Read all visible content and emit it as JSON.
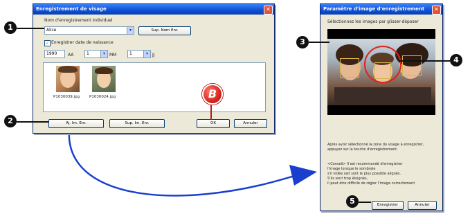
{
  "left_dialog": {
    "title": "Enregistrement de visage",
    "name_label": "Nom d'enregistrement individuel",
    "name_value": "Alice",
    "delete_name_button": "Sup. Nom Enr.",
    "birthdate_checkbox_label": "Enregistrer date de naissance",
    "year_value": "1990",
    "year_unit": "AA",
    "month_value": "1",
    "month_unit": "MM",
    "day_value": "1",
    "day_unit": "JJ",
    "images": [
      {
        "filename": "P1030039.jpg"
      },
      {
        "filename": "P1030024.jpg"
      }
    ],
    "add_image_button": "Aj. Im. Enr.",
    "delete_image_button": "Sup. Im. Enr.",
    "ok_button": "OK",
    "cancel_button": "Annuler"
  },
  "right_dialog": {
    "title": "Paramètre d'image d'enregistrement",
    "instruction": "Sélectionnez les images par glisser-déposer",
    "help_text_1": "Après avoir sélectionné la zone du visage à enregistrer,",
    "help_text_2": "appuyez sur la touche d'enregistrement.",
    "advice_1": "<Conseil> Il est recommandé d'enregistrer",
    "advice_2": "l'image lorsque le sombrale",
    "advice_3": "s'il vidée sait sont le plus possible alignés.",
    "advice_4": "S'ils sont trop éloignés,",
    "advice_5": "il peut être difficile de régler l'image correctement",
    "register_button": "Enregistrer",
    "cancel_button": "Annuler"
  },
  "markers": {
    "m1": "1",
    "m2": "2",
    "m3": "3",
    "m4": "4",
    "m5": "5",
    "mb": "B"
  },
  "colors": {
    "arrow": "#1a3fcf",
    "highlight_ring": "#e0201b",
    "titlebar": "#0d4fd6",
    "marker_b": "#d7261e"
  }
}
